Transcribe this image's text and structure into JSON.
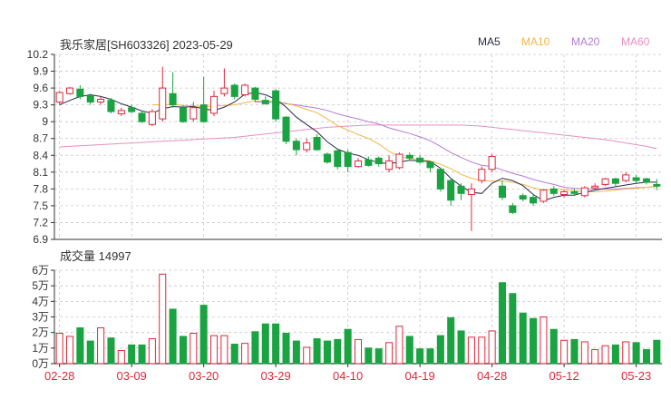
{
  "chart_title": "我乐家居[SH603326] 2023-05-29",
  "legend": [
    {
      "label": "MA5",
      "color": "#2a2a4a"
    },
    {
      "label": "MA10",
      "color": "#f5b642"
    },
    {
      "label": "MA20",
      "color": "#b57ad8"
    },
    {
      "label": "MA60",
      "color": "#e98ec2"
    }
  ],
  "volume_title": "成交量 14997",
  "colors": {
    "up": "#e0283c",
    "down": "#1aa341",
    "grid": "#c8c8c8",
    "axis": "#333333"
  },
  "chart_data": [
    {
      "type": "candlestick",
      "title": "我乐家居[SH603326] 2023-05-29",
      "y_ticks": [
        "10.2",
        "9.9",
        "9.6",
        "9.3",
        "9",
        "8.7",
        "8.4",
        "8.1",
        "7.8",
        "7.5",
        "7.2",
        "6.9"
      ],
      "ylim": [
        6.9,
        10.2
      ],
      "x_ticks": [
        {
          "label": "02-28",
          "index": 0
        },
        {
          "label": "03-09",
          "index": 7
        },
        {
          "label": "03-20",
          "index": 14
        },
        {
          "label": "03-29",
          "index": 21
        },
        {
          "label": "04-10",
          "index": 28
        },
        {
          "label": "04-19",
          "index": 35
        },
        {
          "label": "04-28",
          "index": 42
        },
        {
          "label": "05-12",
          "index": 49
        },
        {
          "label": "05-23",
          "index": 56
        }
      ],
      "n_days": 59,
      "candles": [
        [
          9.35,
          9.52,
          9.55,
          9.3
        ],
        [
          9.5,
          9.6,
          9.62,
          9.48
        ],
        [
          9.58,
          9.45,
          9.65,
          9.4
        ],
        [
          9.46,
          9.35,
          9.5,
          9.3
        ],
        [
          9.35,
          9.4,
          9.45,
          9.3
        ],
        [
          9.38,
          9.18,
          9.42,
          9.15
        ],
        [
          9.14,
          9.2,
          9.25,
          9.1
        ],
        [
          9.25,
          9.18,
          9.3,
          9.15
        ],
        [
          9.15,
          9.0,
          9.2,
          8.98
        ],
        [
          8.95,
          9.18,
          9.22,
          8.92
        ],
        [
          9.05,
          9.6,
          9.98,
          9.0
        ],
        [
          9.5,
          9.3,
          9.88,
          9.25
        ],
        [
          9.25,
          9.0,
          9.3,
          8.98
        ],
        [
          9.05,
          9.25,
          9.35,
          9.0
        ],
        [
          9.3,
          9.0,
          9.8,
          8.98
        ],
        [
          9.15,
          9.45,
          9.55,
          9.1
        ],
        [
          9.5,
          9.6,
          9.95,
          9.45
        ],
        [
          9.65,
          9.45,
          9.68,
          9.4
        ],
        [
          9.48,
          9.65,
          9.68,
          9.45
        ],
        [
          9.6,
          9.4,
          9.62,
          9.35
        ],
        [
          9.38,
          9.32,
          9.45,
          9.3
        ],
        [
          9.55,
          9.05,
          9.58,
          9.0
        ],
        [
          9.08,
          8.65,
          9.1,
          8.6
        ],
        [
          8.65,
          8.5,
          8.7,
          8.4
        ],
        [
          8.5,
          8.62,
          8.7,
          8.45
        ],
        [
          8.72,
          8.5,
          8.78,
          8.48
        ],
        [
          8.42,
          8.28,
          8.45,
          8.25
        ],
        [
          8.48,
          8.2,
          8.52,
          8.15
        ],
        [
          8.45,
          8.2,
          8.5,
          8.1
        ],
        [
          8.2,
          8.3,
          8.35,
          8.18
        ],
        [
          8.32,
          8.22,
          8.38,
          8.2
        ],
        [
          8.35,
          8.25,
          8.38,
          8.2
        ],
        [
          8.15,
          8.3,
          8.4,
          8.1
        ],
        [
          8.18,
          8.42,
          8.45,
          8.15
        ],
        [
          8.4,
          8.35,
          8.45,
          8.3
        ],
        [
          8.35,
          8.28,
          8.4,
          8.25
        ],
        [
          8.28,
          8.18,
          8.3,
          8.1
        ],
        [
          8.15,
          7.8,
          8.18,
          7.75
        ],
        [
          7.95,
          7.6,
          8.0,
          7.5
        ],
        [
          7.85,
          7.72,
          7.9,
          7.6
        ],
        [
          7.7,
          7.8,
          7.9,
          7.05
        ],
        [
          7.95,
          8.15,
          8.2,
          7.9
        ],
        [
          8.15,
          8.38,
          8.42,
          8.1
        ],
        [
          7.85,
          7.65,
          7.95,
          7.6
        ],
        [
          7.5,
          7.38,
          7.55,
          7.35
        ],
        [
          7.68,
          7.62,
          7.72,
          7.58
        ],
        [
          7.65,
          7.55,
          7.7,
          7.5
        ],
        [
          7.58,
          7.78,
          7.8,
          7.55
        ],
        [
          7.8,
          7.72,
          7.85,
          7.68
        ],
        [
          7.7,
          7.75,
          7.78,
          7.65
        ],
        [
          7.75,
          7.72,
          7.8,
          7.7
        ],
        [
          7.68,
          7.82,
          7.85,
          7.65
        ],
        [
          7.82,
          7.85,
          7.9,
          7.8
        ],
        [
          7.88,
          7.98,
          8.0,
          7.85
        ],
        [
          7.98,
          7.9,
          8.0,
          7.85
        ],
        [
          7.95,
          8.05,
          8.1,
          7.92
        ],
        [
          8.0,
          7.95,
          8.05,
          7.9
        ],
        [
          7.98,
          7.92,
          8.0,
          7.88
        ],
        [
          7.88,
          7.85,
          7.98,
          7.78
        ]
      ],
      "ma": {
        "MA5": [
          9.3,
          9.38,
          9.45,
          9.48,
          9.45,
          9.4,
          9.32,
          9.26,
          9.19,
          9.15,
          9.23,
          9.27,
          9.26,
          9.27,
          9.23,
          9.2,
          9.26,
          9.35,
          9.49,
          9.52,
          9.48,
          9.4,
          9.26,
          9.08,
          8.95,
          8.82,
          8.64,
          8.51,
          8.44,
          8.4,
          8.32,
          8.27,
          8.25,
          8.28,
          8.31,
          8.3,
          8.29,
          8.17,
          7.99,
          7.85,
          7.74,
          7.72,
          7.9,
          7.99,
          7.95,
          7.86,
          7.7,
          7.59,
          7.65,
          7.69,
          7.69,
          7.74,
          7.78,
          7.81,
          7.84,
          7.87,
          7.9,
          7.92,
          7.92
        ],
        "MA10": [
          null,
          null,
          null,
          null,
          null,
          null,
          null,
          null,
          null,
          9.3,
          9.3,
          9.31,
          9.29,
          9.28,
          9.27,
          9.28,
          9.29,
          9.3,
          9.34,
          9.37,
          9.37,
          9.36,
          9.33,
          9.28,
          9.22,
          9.16,
          9.05,
          8.93,
          8.85,
          8.77,
          8.7,
          8.6,
          8.47,
          8.38,
          8.34,
          8.32,
          8.3,
          8.24,
          8.16,
          8.06,
          7.99,
          7.95,
          7.94,
          7.94,
          7.92,
          7.88,
          7.82,
          7.78,
          7.79,
          7.79,
          7.77,
          7.75,
          7.75,
          7.76,
          7.78,
          7.8,
          7.81,
          7.83,
          7.84
        ],
        "MA20": [
          null,
          null,
          null,
          null,
          null,
          null,
          null,
          null,
          null,
          null,
          null,
          null,
          null,
          null,
          null,
          null,
          null,
          null,
          null,
          9.35,
          9.35,
          9.34,
          9.32,
          9.3,
          9.27,
          9.24,
          9.2,
          9.14,
          9.09,
          9.05,
          9.0,
          8.96,
          8.89,
          8.84,
          8.79,
          8.73,
          8.66,
          8.56,
          8.45,
          8.36,
          8.28,
          8.22,
          8.2,
          8.14,
          8.08,
          8.03,
          7.97,
          7.92,
          7.88,
          7.83,
          7.81,
          7.8,
          7.8,
          7.8,
          7.8,
          7.81,
          7.82,
          7.83,
          7.84
        ],
        "MA60": [
          8.55,
          8.56,
          8.57,
          8.58,
          8.59,
          8.6,
          8.61,
          8.62,
          8.63,
          8.64,
          8.65,
          8.66,
          8.67,
          8.68,
          8.69,
          8.7,
          8.71,
          8.72,
          8.74,
          8.76,
          8.78,
          8.8,
          8.82,
          8.84,
          8.86,
          8.88,
          8.9,
          8.91,
          8.92,
          8.93,
          8.94,
          8.94,
          8.94,
          8.94,
          8.94,
          8.94,
          8.94,
          8.94,
          8.94,
          8.94,
          8.93,
          8.92,
          8.9,
          8.88,
          8.86,
          8.84,
          8.82,
          8.8,
          8.78,
          8.76,
          8.74,
          8.72,
          8.7,
          8.68,
          8.65,
          8.62,
          8.59,
          8.56,
          8.52
        ]
      }
    },
    {
      "type": "bar",
      "title": "成交量 14997",
      "y_ticks": [
        "6万",
        "5万",
        "4万",
        "3万",
        "2万",
        "1万",
        "0万"
      ],
      "ylim": [
        0,
        6
      ],
      "volumes": [
        1.95,
        1.75,
        2.3,
        1.45,
        2.3,
        1.65,
        0.85,
        1.2,
        1.2,
        1.6,
        5.75,
        3.5,
        1.75,
        1.95,
        3.75,
        1.8,
        1.8,
        1.25,
        1.3,
        2.05,
        2.55,
        2.55,
        1.95,
        1.45,
        1.05,
        1.6,
        1.45,
        1.55,
        2.2,
        1.55,
        1.0,
        0.95,
        1.35,
        2.4,
        1.75,
        0.95,
        0.95,
        1.8,
        2.95,
        2.1,
        1.7,
        1.7,
        2.1,
        5.2,
        4.5,
        3.25,
        2.9,
        3.0,
        2.2,
        1.5,
        1.55,
        1.4,
        0.9,
        1.15,
        1.2,
        1.4,
        1.35,
        0.9,
        1.5
      ]
    }
  ]
}
